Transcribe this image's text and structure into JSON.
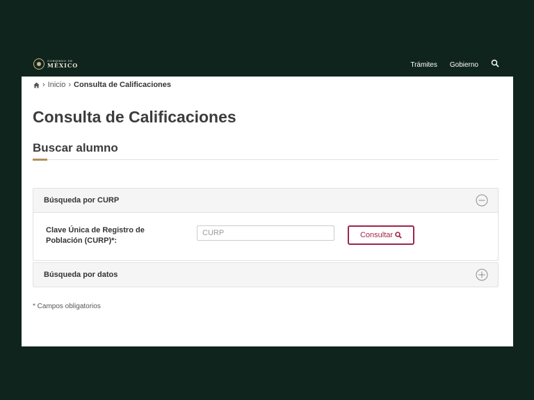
{
  "header": {
    "logo_small": "GOBIERNO DE",
    "logo_big": "MÉXICO",
    "nav": [
      {
        "label": "Trámites"
      },
      {
        "label": "Gobierno"
      }
    ],
    "search_icon": "search-icon"
  },
  "breadcrumb": {
    "home_icon": "home-icon",
    "separator": "›",
    "items": [
      "Inicio",
      "Consulta de Calificaciones"
    ]
  },
  "page": {
    "title": "Consulta de Calificaciones",
    "section_title": "Buscar alumno"
  },
  "curp_section": {
    "title": "Búsqueda por CURP",
    "toggle_icon": "minus-circle-icon",
    "field_label": "Clave Única de Registro de Población (CURP)*:",
    "input_placeholder": "CURP",
    "input_value": "",
    "button_label": "Consultar"
  },
  "data_section": {
    "title": "Búsqueda por datos",
    "toggle_icon": "plus-circle-icon"
  },
  "required_note": "* Campos obligatorios",
  "colors": {
    "background": "#10241e",
    "accent_gold": "#b38e5d",
    "button_border": "#9d2449"
  }
}
